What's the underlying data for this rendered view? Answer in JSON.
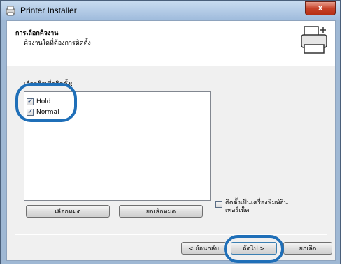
{
  "window": {
    "title": "Printer Installer",
    "close_glyph": "x"
  },
  "header": {
    "title": "การเลือกคิวงาน",
    "subtitle": "คิวงานใดที่ต้องการติดตั้ง",
    "icon": "printer-icon"
  },
  "queue_list": {
    "label": "เลือกคิวเพื่อติดตั้ง:",
    "items": [
      {
        "label": "Hold",
        "checked": true
      },
      {
        "label": "Normal",
        "checked": true
      }
    ]
  },
  "buttons": {
    "select_all": "เลือกหมด",
    "deselect_all": "ยกเลิกหมด",
    "back": "< ย้อนกลับ",
    "next": "ถัดไป >",
    "cancel": "ยกเลิก"
  },
  "network_option": {
    "label_line1": "ติดตั้งเป็นเครื่องพิมพ์อิน",
    "label_line2": "เทอร์เน็ต",
    "checked": false
  },
  "colors": {
    "annotation": "#1f6fb8",
    "title_bar": "#9fbbdc",
    "close_button": "#c7432a"
  }
}
